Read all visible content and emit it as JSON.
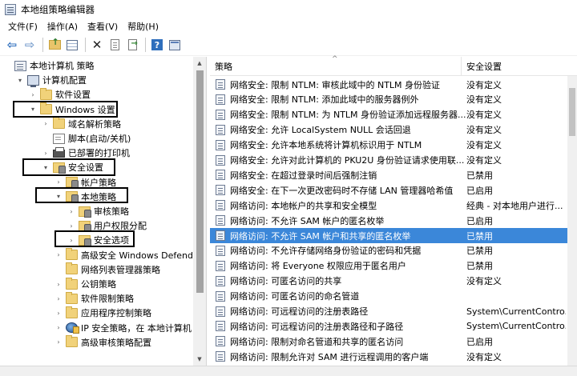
{
  "window": {
    "title": "本地组策略编辑器"
  },
  "menu": [
    "文件(F)",
    "操作(A)",
    "查看(V)",
    "帮助(H)"
  ],
  "toolbar": {
    "icons": [
      "back-arrow-icon",
      "forward-arrow-icon",
      "folder-up-icon",
      "show-hide-tree-icon",
      "delete-icon",
      "properties-icon",
      "export-list-icon",
      "help-icon",
      "console-window-icon"
    ]
  },
  "tree": [
    {
      "label": "本地计算机 策略",
      "icon": "policy",
      "indent": 0,
      "expander": ""
    },
    {
      "label": "计算机配置",
      "icon": "computer",
      "indent": 1,
      "expander": "▾"
    },
    {
      "label": "软件设置",
      "icon": "folder",
      "indent": 2,
      "expander": "›"
    },
    {
      "label": "Windows 设置",
      "icon": "folder",
      "indent": 2,
      "expander": "▾"
    },
    {
      "label": "域名解析策略",
      "icon": "folder",
      "indent": 3,
      "expander": "›"
    },
    {
      "label": "脚本(启动/关机)",
      "icon": "script",
      "indent": 3,
      "expander": ""
    },
    {
      "label": "已部署的打印机",
      "icon": "printer",
      "indent": 3,
      "expander": "›"
    },
    {
      "label": "安全设置",
      "icon": "security",
      "indent": 3,
      "expander": "▾"
    },
    {
      "label": "帐户策略",
      "icon": "security",
      "indent": 4,
      "expander": "›"
    },
    {
      "label": "本地策略",
      "icon": "security",
      "indent": 4,
      "expander": "▾"
    },
    {
      "label": "审核策略",
      "icon": "security",
      "indent": 5,
      "expander": "›"
    },
    {
      "label": "用户权限分配",
      "icon": "security",
      "indent": 5,
      "expander": "›"
    },
    {
      "label": "安全选项",
      "icon": "security",
      "indent": 5,
      "expander": "›"
    },
    {
      "label": "高级安全 Windows Defender",
      "icon": "folder",
      "indent": 4,
      "expander": "›"
    },
    {
      "label": "网络列表管理器策略",
      "icon": "folder",
      "indent": 4,
      "expander": ""
    },
    {
      "label": "公钥策略",
      "icon": "folder",
      "indent": 4,
      "expander": "›"
    },
    {
      "label": "软件限制策略",
      "icon": "folder",
      "indent": 4,
      "expander": "›"
    },
    {
      "label": "应用程序控制策略",
      "icon": "folder",
      "indent": 4,
      "expander": "›"
    },
    {
      "label": "IP 安全策略，在 本地计算机",
      "icon": "ipsec",
      "indent": 4,
      "expander": "›"
    },
    {
      "label": "高级审核策略配置",
      "icon": "folder",
      "indent": 4,
      "expander": "›"
    }
  ],
  "list": {
    "headers": {
      "policy": "策略",
      "setting": "安全设置"
    },
    "rows": [
      {
        "policy": "网络安全: 限制 NTLM: 审核此域中的 NTLM 身份验证",
        "setting": "没有定义"
      },
      {
        "policy": "网络安全: 限制 NTLM: 添加此域中的服务器例外",
        "setting": "没有定义"
      },
      {
        "policy": "网络安全: 限制 NTLM: 为 NTLM 身份验证添加远程服务器...",
        "setting": "没有定义"
      },
      {
        "policy": "网络安全: 允许 LocalSystem NULL 会话回退",
        "setting": "没有定义"
      },
      {
        "policy": "网络安全: 允许本地系统将计算机标识用于 NTLM",
        "setting": "没有定义"
      },
      {
        "policy": "网络安全: 允许对此计算机的 PKU2U 身份验证请求使用联...",
        "setting": "没有定义"
      },
      {
        "policy": "网络安全: 在超过登录时间后强制注销",
        "setting": "已禁用"
      },
      {
        "policy": "网络安全: 在下一次更改密码时不存储 LAN 管理器哈希值",
        "setting": "已启用"
      },
      {
        "policy": "网络访问: 本地帐户的共享和安全模型",
        "setting": "经典 - 对本地用户进行..."
      },
      {
        "policy": "网络访问: 不允许 SAM 帐户的匿名枚举",
        "setting": "已启用"
      },
      {
        "policy": "网络访问: 不允许 SAM 帐户和共享的匿名枚举",
        "setting": "已禁用",
        "selected": true
      },
      {
        "policy": "网络访问: 不允许存储网络身份验证的密码和凭据",
        "setting": "已禁用"
      },
      {
        "policy": "网络访问: 将 Everyone 权限应用于匿名用户",
        "setting": "已禁用"
      },
      {
        "policy": "网络访问: 可匿名访问的共享",
        "setting": "没有定义"
      },
      {
        "policy": "网络访问: 可匿名访问的命名管道",
        "setting": ""
      },
      {
        "policy": "网络访问: 可远程访问的注册表路径",
        "setting": "System\\CurrentContro..."
      },
      {
        "policy": "网络访问: 可远程访问的注册表路径和子路径",
        "setting": "System\\CurrentContro..."
      },
      {
        "policy": "网络访问: 限制对命名管道和共享的匿名访问",
        "setting": "已启用"
      },
      {
        "policy": "网络访问: 限制允许对 SAM 进行远程调用的客户端",
        "setting": "没有定义"
      }
    ]
  }
}
